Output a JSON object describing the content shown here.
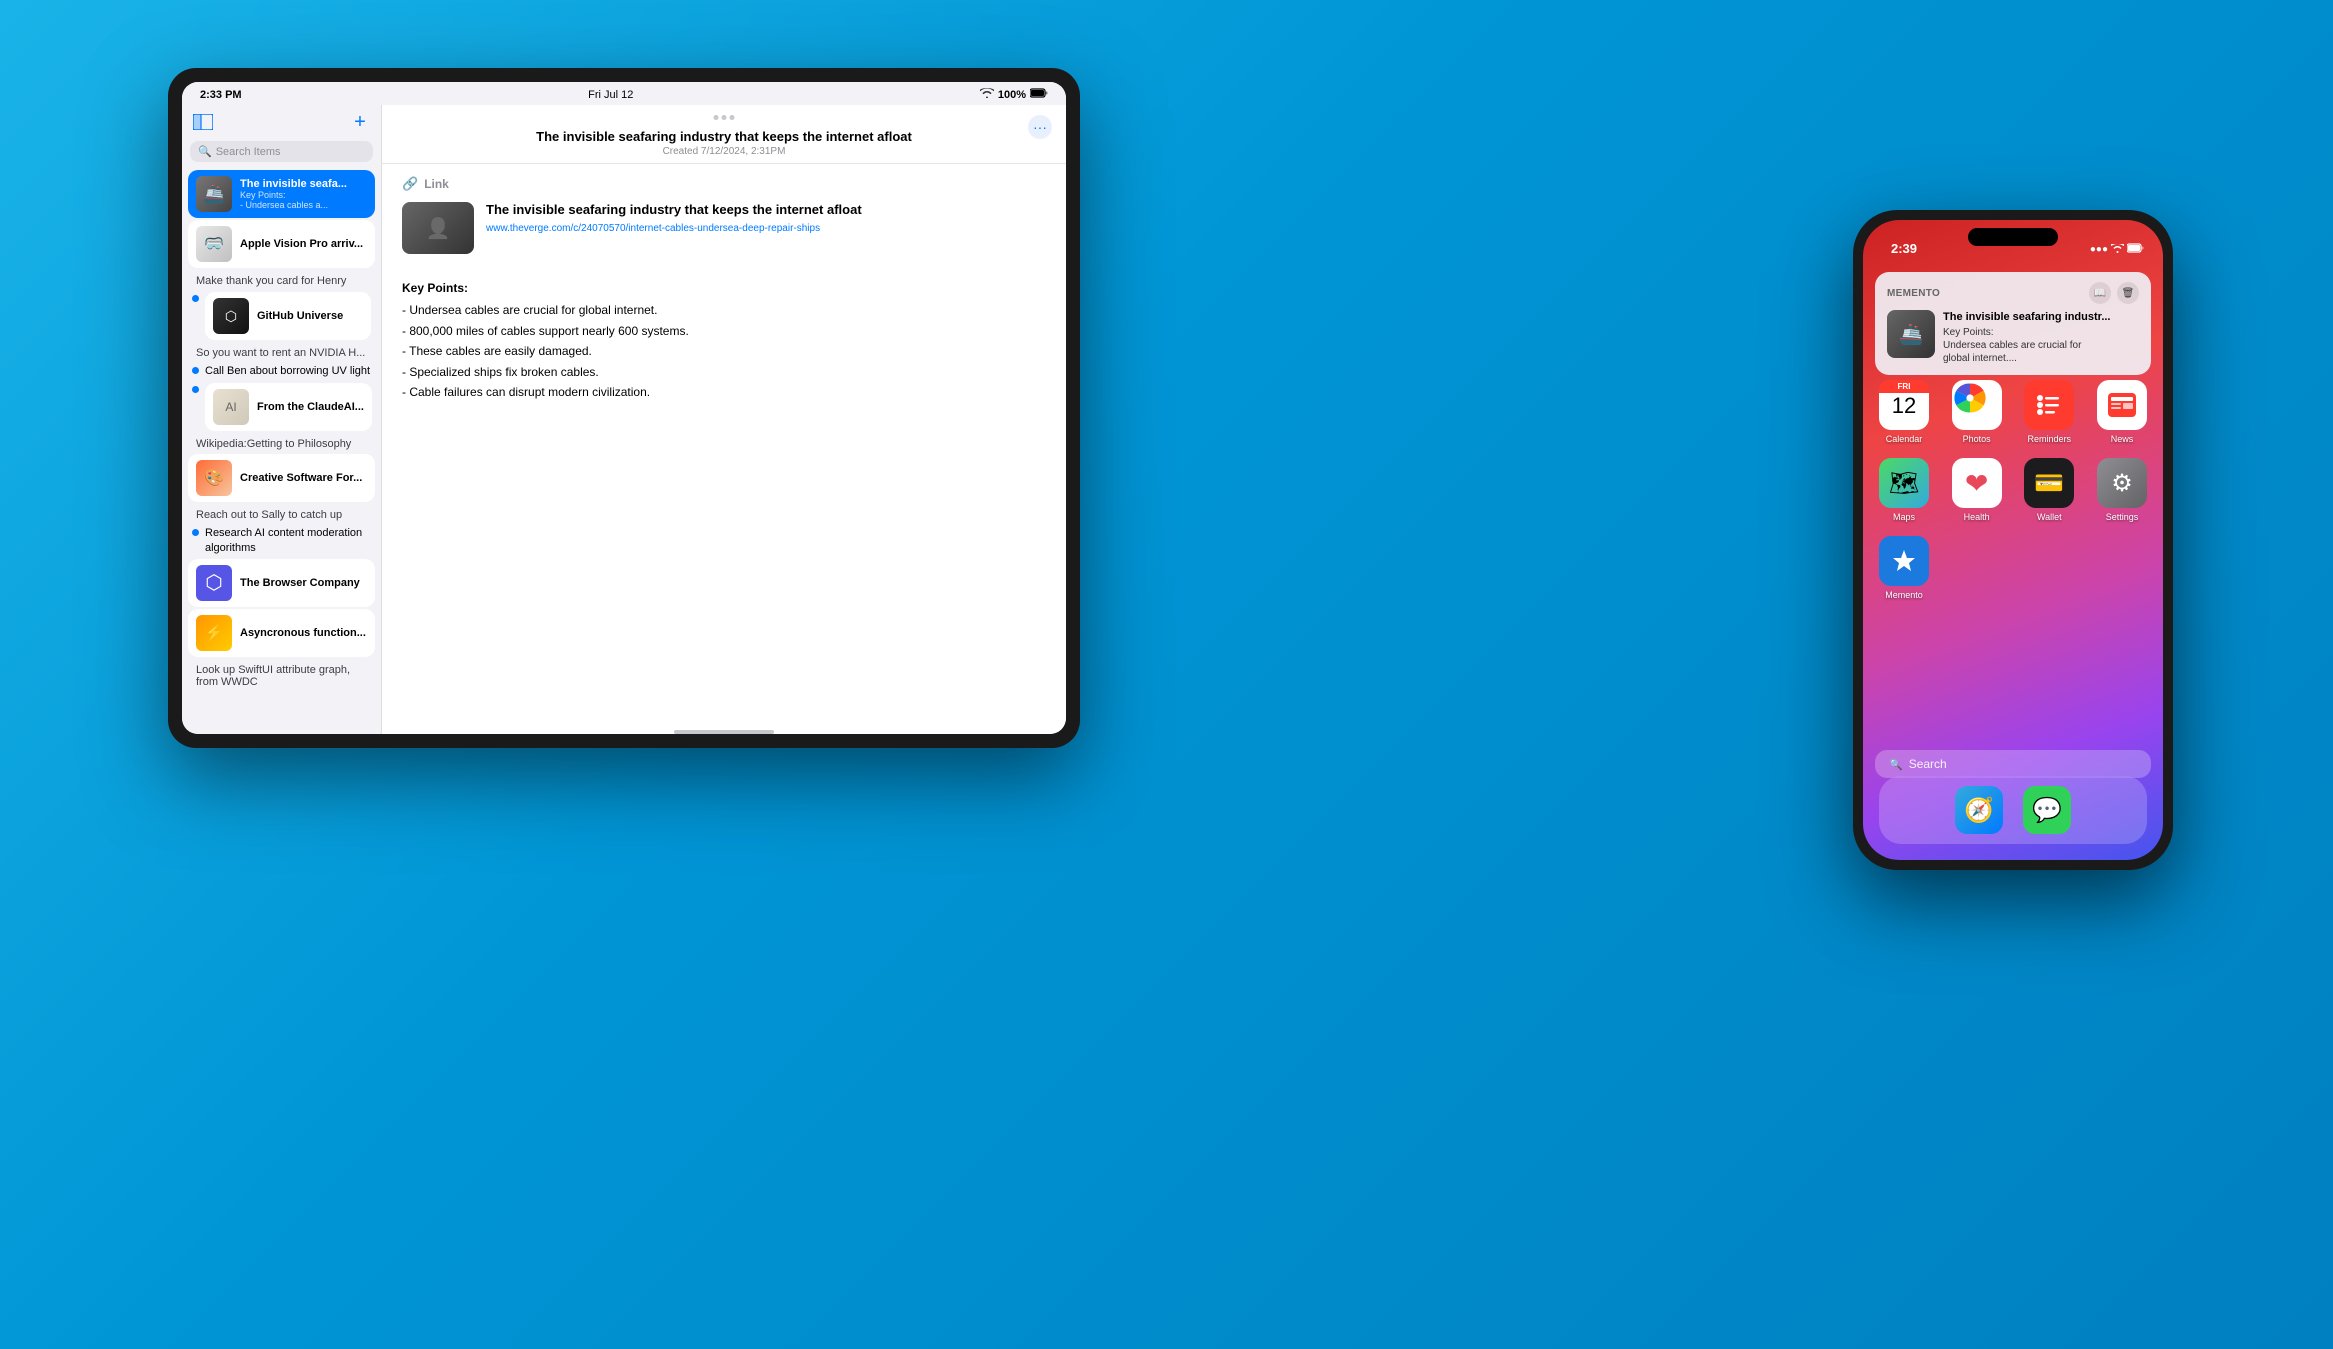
{
  "background": {
    "color": "#0099d6"
  },
  "tablet": {
    "status_bar": {
      "time": "2:33 PM",
      "date": "Fri Jul 12",
      "wifi": "wifi",
      "battery": "100%"
    },
    "sidebar": {
      "search_placeholder": "Search Items",
      "new_button_label": "+",
      "items": [
        {
          "id": "invisible-seafaring",
          "title": "The invisible seafa...",
          "subtitle": "Key Points:\n- Undersea cables a...",
          "type": "card",
          "active": true,
          "thumb_type": "seafaring"
        },
        {
          "id": "apple-vision",
          "title": "Apple Vision Pro arriv...",
          "subtitle": "",
          "type": "card",
          "active": false,
          "thumb_type": "apple-vision"
        }
      ],
      "plain_items": [
        {
          "id": "henry-card",
          "text": "Make thank you card for Henry",
          "type": "plain"
        },
        {
          "id": "github-universe",
          "title": "GitHub Universe",
          "type": "dot-card",
          "has_dot": true,
          "thumb_type": "github"
        },
        {
          "id": "nvidia",
          "text": "So you want to rent an NVIDIA H...",
          "type": "plain"
        },
        {
          "id": "call-ben",
          "text": "Call Ben about borrowing UV light",
          "type": "dot",
          "has_dot": true
        },
        {
          "id": "claude-ai",
          "title": "From the ClaudeAI...",
          "type": "dot-card",
          "has_dot": true,
          "thumb_type": "claude"
        },
        {
          "id": "wikipedia",
          "text": "Wikipedia:Getting to Philosophy",
          "type": "plain"
        },
        {
          "id": "creative-software",
          "title": "Creative Software For...",
          "type": "card",
          "active": false,
          "thumb_type": "creative"
        },
        {
          "id": "reach-sally",
          "text": "Reach out to Sally to catch up",
          "type": "plain"
        },
        {
          "id": "research-ai",
          "text": "Research AI content moderation algorithms",
          "type": "dot",
          "has_dot": true
        },
        {
          "id": "browser-co",
          "title": "The Browser Company",
          "type": "card",
          "active": false,
          "thumb_type": "browser-co"
        },
        {
          "id": "async",
          "title": "Asyncronous function...",
          "type": "card",
          "active": false,
          "thumb_type": "async"
        },
        {
          "id": "look-up-swiftui",
          "text": "Look up SwiftUI attribute graph, from WWDC",
          "type": "plain"
        }
      ]
    },
    "main": {
      "header_dots": 3,
      "title": "The invisible seafaring industry that keeps the internet afloat",
      "date": "Created 7/12/2024, 2:31PM",
      "link_label": "Link",
      "article_title": "The invisible seafaring industry that keeps the internet afloat",
      "article_url": "www.theverge.com/c/24070570/internet-cables-undersea-deep-repair-ships",
      "key_points_header": "Key Points:",
      "key_points": [
        "- Undersea cables are crucial for global internet.",
        "- 800,000 miles of cables support nearly 600 systems.",
        "- These cables are easily damaged.",
        "- Specialized ships fix broken cables.",
        "- Cable failures can disrupt modern civilization."
      ]
    }
  },
  "phone": {
    "status_bar": {
      "time": "2:39",
      "signal": "●●●",
      "wifi": "wifi",
      "battery": "battery"
    },
    "notification": {
      "app_name": "Memento",
      "title": "The invisible seafaring industr...",
      "subtitle": "Key Points:\nUndersea cables are crucial for\nglobal internet....",
      "actions": [
        "book-icon",
        "trash-icon"
      ]
    },
    "icons_row1": [
      {
        "id": "calendar",
        "type": "calendar",
        "label": "Calendar",
        "date_header": "FRI",
        "date_num": "12"
      },
      {
        "id": "photos",
        "type": "photos",
        "label": "Photos"
      },
      {
        "id": "reminders",
        "type": "reminders",
        "label": "Reminders",
        "icon": "≡"
      },
      {
        "id": "news",
        "type": "news",
        "label": "News",
        "icon": "N"
      }
    ],
    "icons_row2": [
      {
        "id": "maps",
        "type": "maps",
        "label": "Maps",
        "icon": "🗺"
      },
      {
        "id": "health",
        "type": "health",
        "label": "Health",
        "icon": "♥"
      },
      {
        "id": "wallet",
        "type": "wallet",
        "label": "Wallet",
        "icon": "💳"
      },
      {
        "id": "settings",
        "type": "settings",
        "label": "Settings",
        "icon": "⚙"
      }
    ],
    "icons_row3": [
      {
        "id": "memento",
        "type": "memento",
        "label": "Memento",
        "icon": "✦"
      }
    ],
    "search": {
      "icon": "🔍",
      "text": "Search"
    },
    "dock": [
      {
        "id": "safari",
        "type": "safari",
        "icon": "🧭"
      },
      {
        "id": "messages",
        "type": "messages",
        "icon": "💬"
      }
    ]
  }
}
